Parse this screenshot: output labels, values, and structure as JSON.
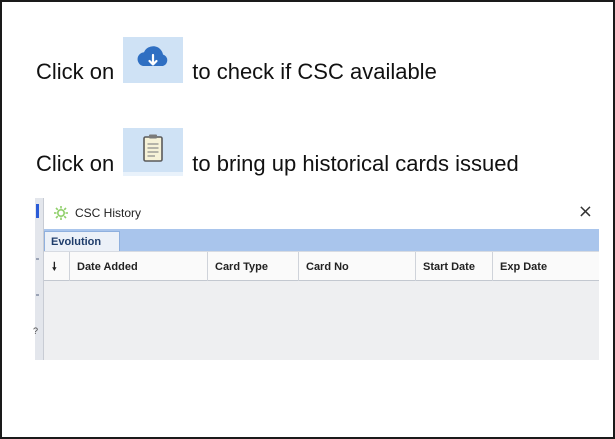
{
  "instructions": {
    "line1": {
      "prefix": "Click on",
      "icon": "cloud-download-icon",
      "suffix": "to check if CSC available"
    },
    "line2": {
      "prefix": "Click on",
      "icon": "clipboard-icon",
      "suffix": "to bring up historical cards issued"
    }
  },
  "window": {
    "title": "CSC History",
    "title_icon": "gear-icon",
    "close_label": "×",
    "tabs": [
      {
        "label": "Evolution",
        "active": true
      }
    ],
    "columns": [
      {
        "label": "🠗"
      },
      {
        "label": "Date Added"
      },
      {
        "label": "Card Type"
      },
      {
        "label": "Card No"
      },
      {
        "label": "Start Date"
      },
      {
        "label": "Exp Date"
      }
    ],
    "rows": []
  },
  "colors": {
    "icon_tile": "#cfe2f5",
    "cloud": "#2f6fc2",
    "tabstrip": "#a9c5ec",
    "grid_body": "#eeeff1"
  }
}
